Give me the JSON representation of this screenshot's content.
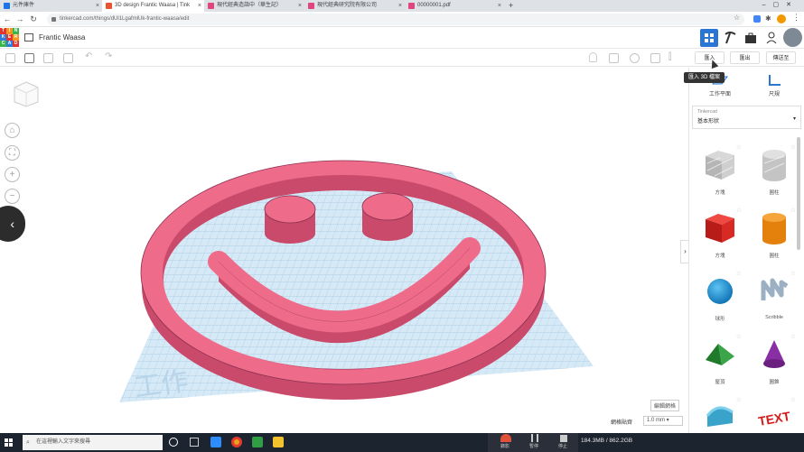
{
  "browser": {
    "tabs": [
      {
        "title": "元件庫件",
        "favicon": "#1a73e8"
      },
      {
        "title": "3D design Frantic Waasa | Tink",
        "favicon": "#e9542f"
      },
      {
        "title": "現代經典造詣中（華生記）",
        "favicon": "#e0457b"
      },
      {
        "title": "現代經典研究院有限公司",
        "favicon": "#e0457b"
      },
      {
        "title": "00000001.pdf",
        "favicon": "#e0457b"
      }
    ],
    "url": "tinkercad.com/things/dUl1LgafmlUk-frantic-waasa/edit",
    "new_tab": "+"
  },
  "app": {
    "logo_letters": [
      "T",
      "I",
      "N",
      "K",
      "E",
      "R",
      "C",
      "A",
      "D"
    ],
    "logo_colors": [
      "#e2352f",
      "#f7961e",
      "#3ab54a",
      "#2f7ddb",
      "#e2352f",
      "#f7961e",
      "#3ab54a",
      "#2f7ddb",
      "#e2352f"
    ],
    "title": "Frantic Waasa",
    "accent": "#2a76d2"
  },
  "toolbar": {
    "import_label": "匯入",
    "export_label": "匯出",
    "send_label": "傳送至"
  },
  "tooltip": "匯入 3D 檔案",
  "workplane_text": "工作",
  "controls": {
    "edit_grid": "編輯網格",
    "snap_label": "網格貼齊",
    "snap_value": "1.0 mm ▾"
  },
  "panel": {
    "top_items": [
      "工作平面",
      "尺規"
    ],
    "dropdown_caption": "Tinkercad",
    "dropdown_value": "基本形狀",
    "shapes": [
      {
        "label": "方塊",
        "icon": "box-hole-icon"
      },
      {
        "label": "圓柱",
        "icon": "cylinder-hole-icon"
      },
      {
        "label": "方塊",
        "icon": "box-icon"
      },
      {
        "label": "圓柱",
        "icon": "cylinder-icon"
      },
      {
        "label": "球形",
        "icon": "sphere-icon"
      },
      {
        "label": "Scribble",
        "icon": "scribble-icon"
      },
      {
        "label": "屋頂",
        "icon": "roof-icon"
      },
      {
        "label": "圓錐",
        "icon": "cone-icon"
      },
      {
        "label": "",
        "icon": "half-cylinder-icon"
      },
      {
        "label": "",
        "icon": "text-icon"
      }
    ]
  },
  "taskbar": {
    "search_placeholder": "在這裡輸入文字來搜尋",
    "memory": "184.3MB / 862.2GB",
    "tray_labels": [
      "錄影",
      "暫停",
      "停止"
    ]
  },
  "colors": {
    "shape_pink": "#ef6b8a",
    "shape_pink_dark": "#c94a6a",
    "workplane": "#cfe3f2",
    "grid_line": "#9cc4e0"
  }
}
